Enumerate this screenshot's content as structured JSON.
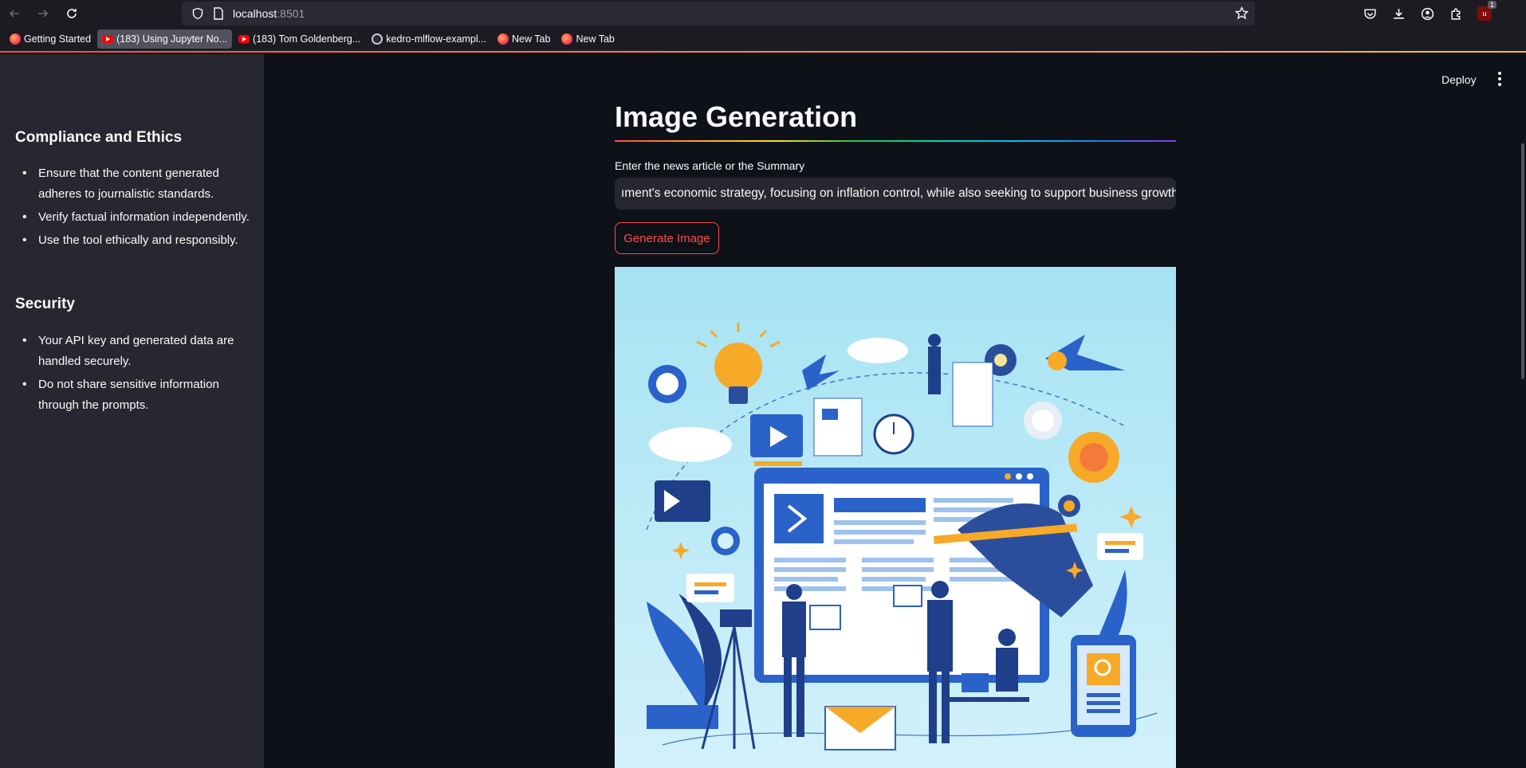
{
  "browser": {
    "url_host": "localhost",
    "url_port": ":8501",
    "notification_count": "1",
    "bookmarks": [
      {
        "label": "Getting Started",
        "icon": "firefox-icon"
      },
      {
        "label": "(183) Using Jupyter No...",
        "icon": "youtube-icon"
      },
      {
        "label": "(183) Tom Goldenberg...",
        "icon": "youtube-icon"
      },
      {
        "label": "kedro-mlflow-exampl...",
        "icon": "github-icon"
      },
      {
        "label": "New Tab",
        "icon": "firefox-icon"
      },
      {
        "label": "New Tab",
        "icon": "firefox-icon"
      }
    ]
  },
  "sidebar": {
    "compliance": {
      "heading": "Compliance and Ethics",
      "items": [
        "Ensure that the content generated adheres to journalistic standards.",
        "Verify factual information independently.",
        "Use the tool ethically and responsibly."
      ]
    },
    "security": {
      "heading": "Security",
      "items": [
        "Your API key and generated data are handled securely.",
        "Do not share sensitive information through the prompts."
      ]
    }
  },
  "header": {
    "deploy_label": "Deploy"
  },
  "main": {
    "title": "Image Generation",
    "input_label": "Enter the news article or the Summary",
    "input_value": "ıment's economic strategy, focusing on inflation control, while also seeking to support business growth.",
    "button_label": "Generate Image"
  },
  "colors": {
    "accent": "#ff4b4b",
    "sidebar_bg": "#262730",
    "main_bg": "#0e1117"
  }
}
